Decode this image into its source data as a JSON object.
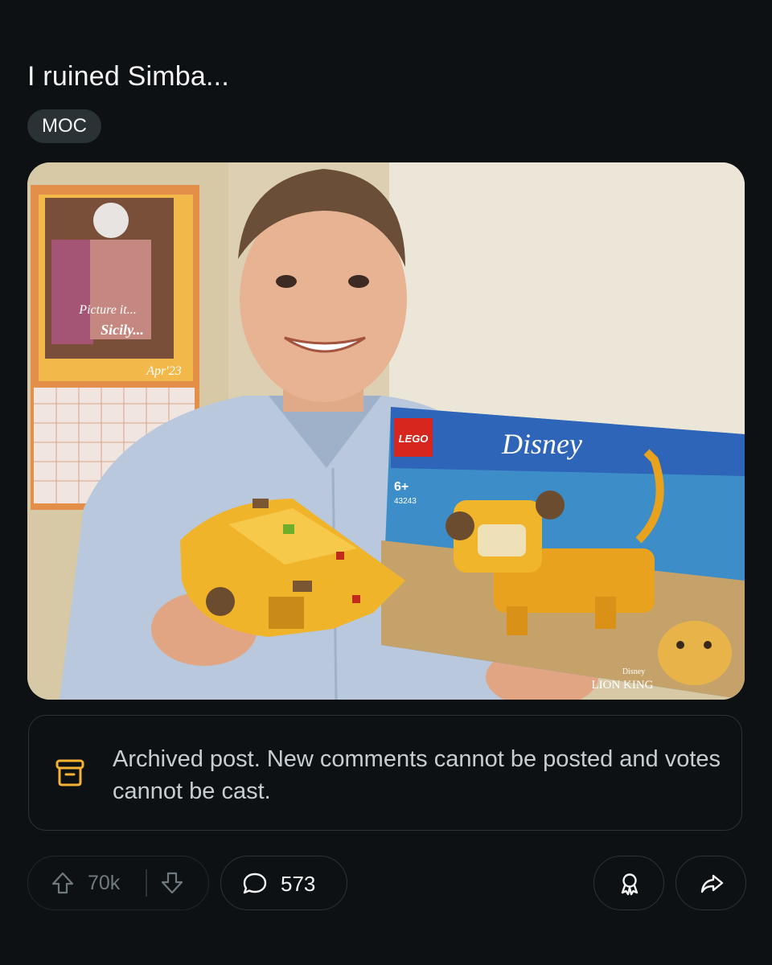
{
  "post": {
    "title": "I ruined Simba...",
    "flair": "MOC"
  },
  "image": {
    "calendar_caption_line1": "Picture it...",
    "calendar_caption_line2": "Sicily...",
    "calendar_month": "Apr'23",
    "box_brand": "LEGO",
    "box_franchise": "Disney",
    "box_age": "6+",
    "box_set_number": "43243",
    "box_title_small": "Disney",
    "box_title": "LION KING"
  },
  "archived_notice": {
    "icon": "archive-icon",
    "text": "Archived post. New comments cannot be posted and votes cannot be cast."
  },
  "actions": {
    "upvote_icon": "upvote-arrow-icon",
    "vote_count": "70k",
    "downvote_icon": "downvote-arrow-icon",
    "comment_icon": "comment-bubble-icon",
    "comment_count": "573",
    "award_icon": "award-icon",
    "share_icon": "share-icon"
  },
  "colors": {
    "background": "#0e1113",
    "flair_bg": "#2a3236",
    "archive_icon": "#f5b335",
    "muted_text": "#6f7a80"
  }
}
